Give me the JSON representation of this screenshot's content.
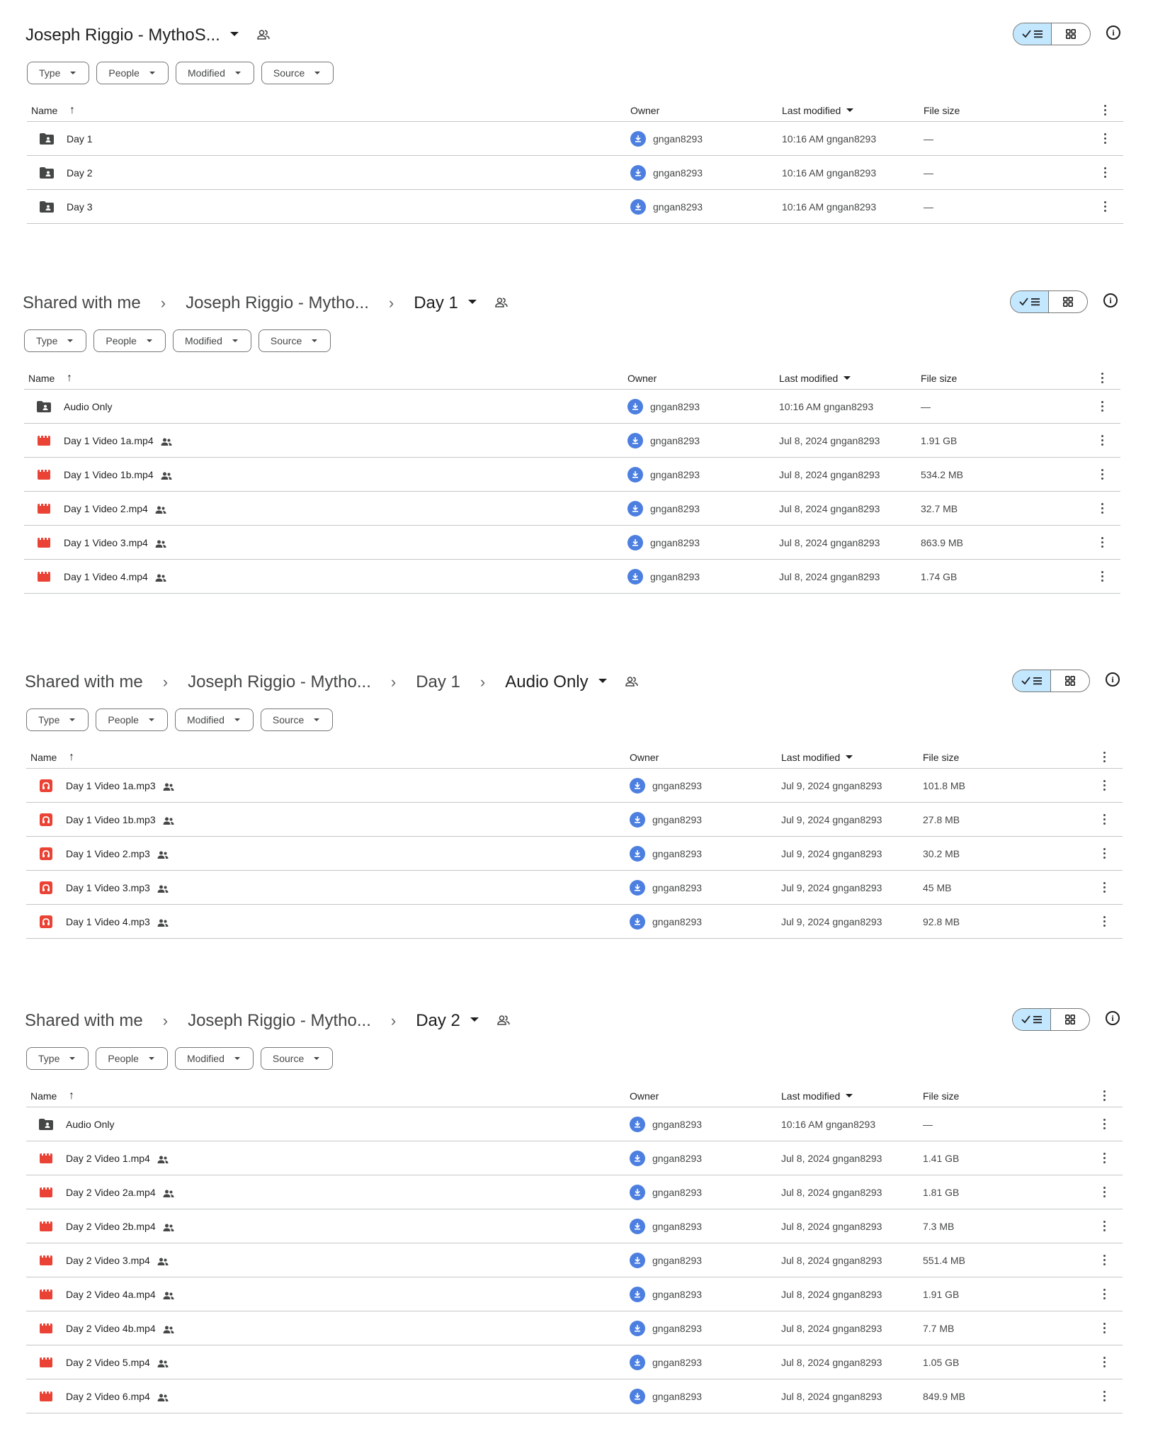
{
  "common": {
    "filters": [
      "Type",
      "People",
      "Modified",
      "Source"
    ],
    "columns": {
      "name": "Name",
      "owner": "Owner",
      "modified": "Last modified",
      "size": "File size"
    },
    "owner": "gngan8293",
    "accent": "#c2e7ff"
  },
  "panel1": {
    "breadcrumb": [
      "Joseph Riggio - MythoS..."
    ],
    "rows": [
      {
        "icon": "shared-folder-icon",
        "name": "Day 1",
        "modified": "10:16 AM gngan8293",
        "size": "—"
      },
      {
        "icon": "shared-folder-icon",
        "name": "Day 2",
        "modified": "10:16 AM gngan8293",
        "size": "—"
      },
      {
        "icon": "shared-folder-icon",
        "name": "Day 3",
        "modified": "10:16 AM gngan8293",
        "size": "—"
      }
    ]
  },
  "panel2": {
    "breadcrumb": [
      "Shared with me",
      "Joseph Riggio - Mytho...",
      "Day 1"
    ],
    "rows": [
      {
        "icon": "shared-folder-icon",
        "name": "Audio Only",
        "modified": "10:16 AM gngan8293",
        "size": "—"
      },
      {
        "icon": "video-icon",
        "name": "Day 1 Video 1a.mp4",
        "modified": "Jul 8, 2024 gngan8293",
        "size": "1.91 GB"
      },
      {
        "icon": "video-icon",
        "name": "Day 1 Video 1b.mp4",
        "modified": "Jul 8, 2024 gngan8293",
        "size": "534.2 MB"
      },
      {
        "icon": "video-icon",
        "name": "Day 1 Video 2.mp4",
        "modified": "Jul 8, 2024 gngan8293",
        "size": "32.7 MB"
      },
      {
        "icon": "video-icon",
        "name": "Day 1 Video 3.mp4",
        "modified": "Jul 8, 2024 gngan8293",
        "size": "863.9 MB"
      },
      {
        "icon": "video-icon",
        "name": "Day 1 Video 4.mp4",
        "modified": "Jul 8, 2024 gngan8293",
        "size": "1.74 GB"
      }
    ]
  },
  "panel3": {
    "breadcrumb": [
      "Shared with me",
      "Joseph Riggio - Mytho...",
      "Day 1",
      "Audio Only"
    ],
    "rows": [
      {
        "icon": "audio-icon",
        "name": "Day 1 Video 1a.mp3",
        "modified": "Jul 9, 2024 gngan8293",
        "size": "101.8 MB"
      },
      {
        "icon": "audio-icon",
        "name": "Day 1 Video 1b.mp3",
        "modified": "Jul 9, 2024 gngan8293",
        "size": "27.8 MB"
      },
      {
        "icon": "audio-icon",
        "name": "Day 1 Video 2.mp3",
        "modified": "Jul 9, 2024 gngan8293",
        "size": "30.2 MB"
      },
      {
        "icon": "audio-icon",
        "name": "Day 1 Video 3.mp3",
        "modified": "Jul 9, 2024 gngan8293",
        "size": "45 MB"
      },
      {
        "icon": "audio-icon",
        "name": "Day 1 Video 4.mp3",
        "modified": "Jul 9, 2024 gngan8293",
        "size": "92.8 MB"
      }
    ]
  },
  "panel4": {
    "breadcrumb": [
      "Shared with me",
      "Joseph Riggio - Mytho...",
      "Day 2"
    ],
    "rows": [
      {
        "icon": "shared-folder-icon",
        "name": "Audio Only",
        "modified": "10:16 AM gngan8293",
        "size": "—"
      },
      {
        "icon": "video-icon",
        "name": "Day 2 Video 1.mp4",
        "modified": "Jul 8, 2024 gngan8293",
        "size": "1.41 GB"
      },
      {
        "icon": "video-icon",
        "name": "Day 2 Video 2a.mp4",
        "modified": "Jul 8, 2024 gngan8293",
        "size": "1.81 GB"
      },
      {
        "icon": "video-icon",
        "name": "Day 2 Video 2b.mp4",
        "modified": "Jul 8, 2024 gngan8293",
        "size": "7.3 MB"
      },
      {
        "icon": "video-icon",
        "name": "Day 2 Video 3.mp4",
        "modified": "Jul 8, 2024 gngan8293",
        "size": "551.4 MB"
      },
      {
        "icon": "video-icon",
        "name": "Day 2 Video 4a.mp4",
        "modified": "Jul 8, 2024 gngan8293",
        "size": "1.91 GB"
      },
      {
        "icon": "video-icon",
        "name": "Day 2 Video 4b.mp4",
        "modified": "Jul 8, 2024 gngan8293",
        "size": "7.7 MB"
      },
      {
        "icon": "video-icon",
        "name": "Day 2 Video 5.mp4",
        "modified": "Jul 8, 2024 gngan8293",
        "size": "1.05 GB"
      },
      {
        "icon": "video-icon",
        "name": "Day 2 Video 6.mp4",
        "modified": "Jul 8, 2024 gngan8293",
        "size": "849.9 MB"
      }
    ]
  }
}
